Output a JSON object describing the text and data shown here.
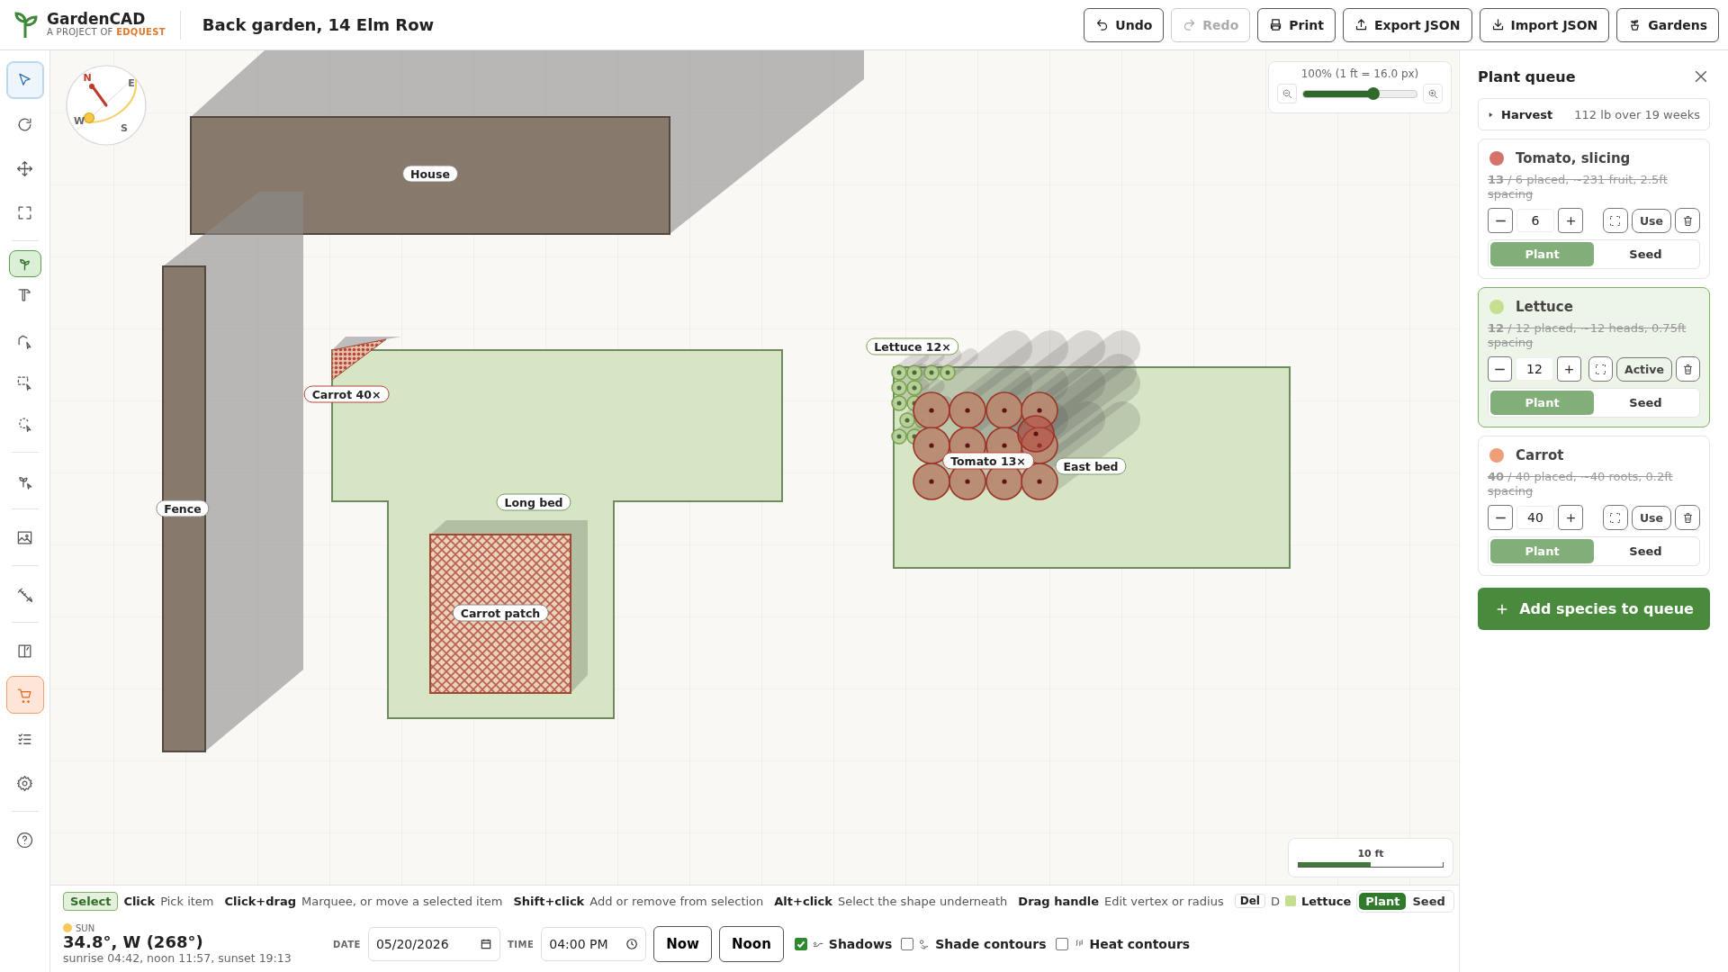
{
  "app": {
    "name": "GardenCAD",
    "tagline_prefix": "A PROJECT OF",
    "tagline_brand": "EDQUEST"
  },
  "document_title": "Back garden, 14 Elm Row",
  "toolbar_buttons": [
    {
      "kind": "undo",
      "label": "Undo",
      "disabled": false
    },
    {
      "kind": "redo",
      "label": "Redo",
      "disabled": true
    },
    {
      "kind": "print",
      "label": "Print",
      "disabled": false
    },
    {
      "kind": "export",
      "label": "Export JSON",
      "disabled": false
    },
    {
      "kind": "import",
      "label": "Import JSON",
      "disabled": false
    },
    {
      "kind": "gardens",
      "label": "Gardens",
      "disabled": false
    }
  ],
  "tool_groups": [
    [
      {
        "kind": "select",
        "selected": true,
        "on": false
      },
      {
        "kind": "rotate",
        "selected": false,
        "on": false
      },
      {
        "kind": "move",
        "selected": false,
        "on": false
      },
      {
        "kind": "fit",
        "selected": false,
        "on": false
      }
    ],
    [
      {
        "kind": "plant",
        "selected": false,
        "on": true
      },
      {
        "kind": "build",
        "selected": false,
        "on": false
      },
      {
        "kind": "polygon",
        "selected": false,
        "on": false
      },
      {
        "kind": "rect",
        "selected": false,
        "on": false
      },
      {
        "kind": "lasso",
        "selected": false,
        "on": false
      }
    ],
    [
      {
        "kind": "plant-select",
        "selected": false,
        "on": false
      }
    ],
    [
      {
        "kind": "image",
        "selected": false,
        "on": false
      }
    ],
    [
      {
        "kind": "measure",
        "selected": false,
        "on": false
      }
    ],
    [
      {
        "kind": "compare",
        "selected": false,
        "on": false
      },
      {
        "kind": "cart",
        "selected": false,
        "on": true
      },
      {
        "kind": "checklist",
        "selected": false,
        "on": false
      },
      {
        "kind": "settings",
        "selected": false,
        "on": false
      }
    ],
    [
      {
        "kind": "help",
        "selected": false,
        "on": false
      }
    ]
  ],
  "compass": {
    "letters": [
      "N",
      "E",
      "W",
      "S"
    ]
  },
  "zoom": {
    "reading": "100% (1 ft = 16.0 px)",
    "level": 0.62
  },
  "scale_bar": {
    "label": "10 ft"
  },
  "canvas": {
    "objects": [
      {
        "kind": "house",
        "label": "House"
      },
      {
        "kind": "fence",
        "label": "Fence"
      },
      {
        "kind": "bed",
        "label": "Long bed"
      },
      {
        "kind": "patch",
        "label": "Carrot patch"
      },
      {
        "kind": "bed",
        "label": "East bed"
      },
      {
        "kind": "carrot-plants",
        "label": "Carrot 40×"
      },
      {
        "kind": "lettuce-plants",
        "label": "Lettuce 12×"
      },
      {
        "kind": "tomato-plants",
        "label": "Tomato 13×"
      }
    ]
  },
  "hint_bar": {
    "mode": "Select",
    "hints": [
      {
        "key": "Click",
        "text": "Pick item"
      },
      {
        "key": "Click+drag",
        "text": "Marquee, or move a selected item"
      },
      {
        "key": "Shift+click",
        "text": "Add or remove from selection"
      },
      {
        "key": "Alt+click",
        "text": "Select the shape underneath"
      },
      {
        "key": "Drag handle",
        "text": "Edit vertex or radius"
      }
    ],
    "delete_key": "Del",
    "delete_hint": "D",
    "species": {
      "name": "Lettuce",
      "color": "#c5de8f"
    },
    "modes": [
      {
        "label": "Plant",
        "selected": true
      },
      {
        "label": "Seed",
        "selected": false
      }
    ]
  },
  "sun": {
    "label": "SUN",
    "position": "34.8°, W (268°)",
    "times": "sunrise 04:42, noon 11:57, sunset 19:13",
    "date_label": "DATE",
    "date": "05/20/2026",
    "time_label": "TIME",
    "time": "04:00 PM",
    "buttons": [
      "Now",
      "Noon"
    ],
    "layers": [
      {
        "kind": "shadows",
        "label": "Shadows",
        "checked": true
      },
      {
        "kind": "shade",
        "label": "Shade contours",
        "checked": false
      },
      {
        "kind": "heat",
        "label": "Heat contours",
        "checked": false
      }
    ]
  },
  "plant_queue": {
    "title": "Plant queue",
    "harvest": {
      "label": "Harvest",
      "summary": "112 lb over 19 weeks",
      "expanded": false
    },
    "species": [
      {
        "name": "Tomato, slicing",
        "color": "#d4736b",
        "summary": "**13** / 6 placed, ~231 fruit, 2.5ft spacing",
        "quantity": "6",
        "use_label": "Use",
        "selected": false,
        "modes": [
          {
            "label": "Plant",
            "selected": true
          },
          {
            "label": "Seed",
            "selected": false
          }
        ]
      },
      {
        "name": "Lettuce",
        "color": "#c5de8f",
        "summary": "**12** / 12 placed, ~12 heads, 0.75ft spacing",
        "quantity": "12",
        "use_label": "Active",
        "selected": true,
        "modes": [
          {
            "label": "Plant",
            "selected": true
          },
          {
            "label": "Seed",
            "selected": false
          }
        ]
      },
      {
        "name": "Carrot",
        "color": "#ee9e78",
        "summary": "**40** / 40 placed, ~40 roots, 0.2ft spacing",
        "quantity": "40",
        "use_label": "Use",
        "selected": false,
        "modes": [
          {
            "label": "Plant",
            "selected": true
          },
          {
            "label": "Seed",
            "selected": false
          }
        ]
      }
    ],
    "add_button": "Add species to queue"
  }
}
